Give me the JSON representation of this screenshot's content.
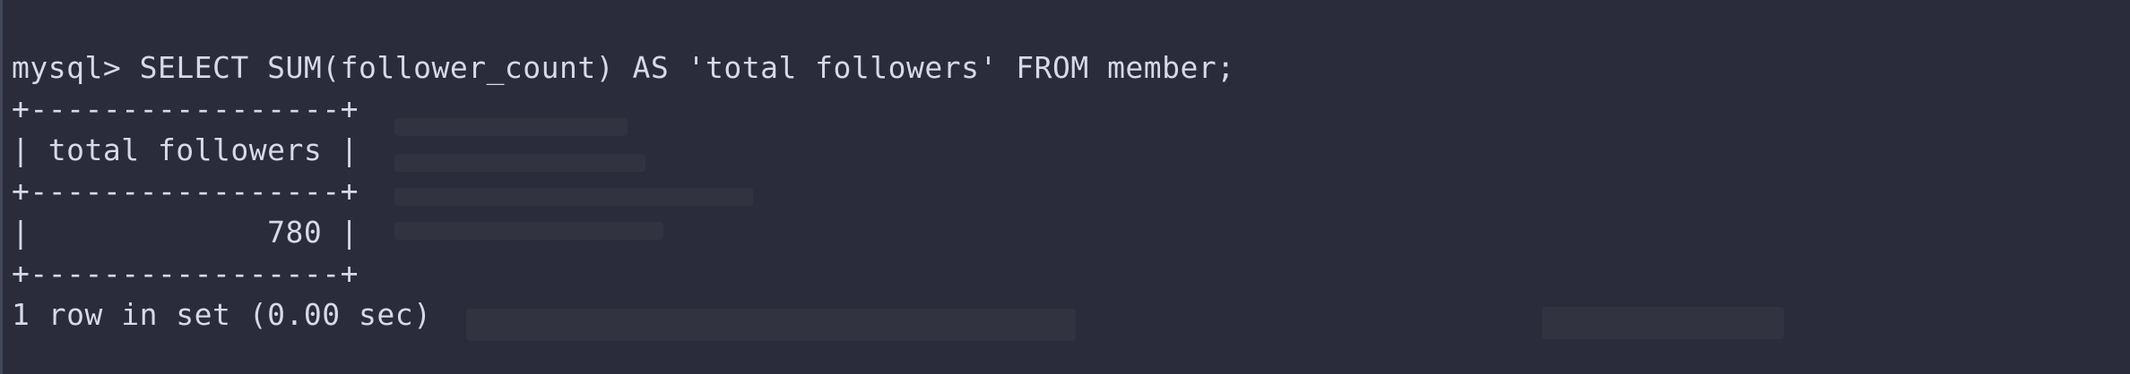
{
  "terminal": {
    "prompt": "mysql> ",
    "command": "SELECT SUM(follower_count) AS 'total followers' FROM member;",
    "table_border": "+-----------------+",
    "header_row": "| total followers |",
    "value_row": "|             780 |",
    "result_summary": "1 row in set (0.00 sec)"
  },
  "colors": {
    "background": "#2a2c3b",
    "text": "#d6d9e6"
  }
}
